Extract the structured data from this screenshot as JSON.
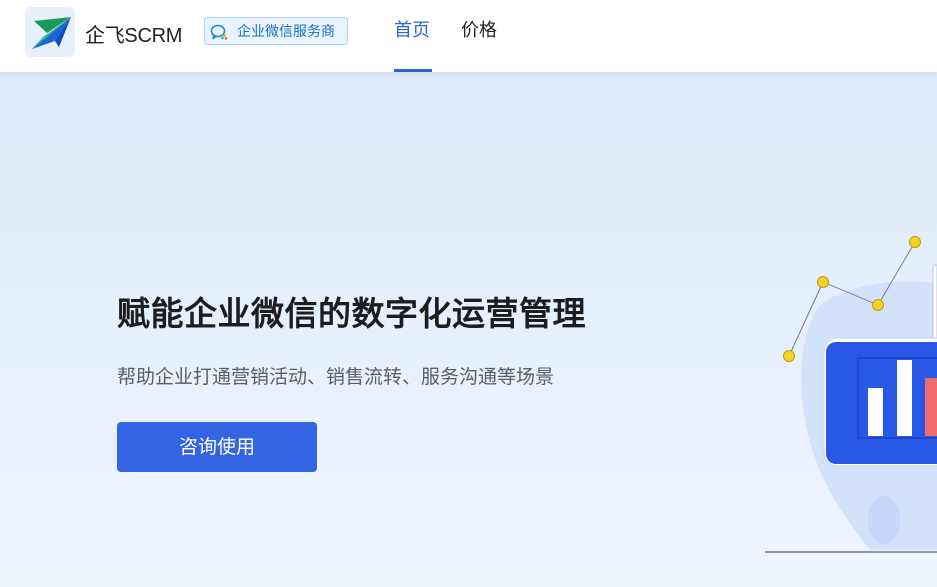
{
  "header": {
    "brand": "企飞SCRM",
    "badge": "企业微信服务商",
    "nav": [
      {
        "label": "首页",
        "active": true
      },
      {
        "label": "价格",
        "active": false
      }
    ]
  },
  "hero": {
    "title": "赋能企业微信的数字化运营管理",
    "subtitle": "帮助企业打通营销活动、销售流转、服务沟通等场景",
    "cta": "咨询使用"
  },
  "colors": {
    "accent": "#3464e4",
    "nav_active": "#2f63d7",
    "badge_text": "#1b6fc2",
    "chart_bar_red": "#f26b6b",
    "dot_yellow": "#f5d22b"
  },
  "icons": {
    "logo": "paper-plane-logo",
    "badge": "wechat-work-icon"
  }
}
